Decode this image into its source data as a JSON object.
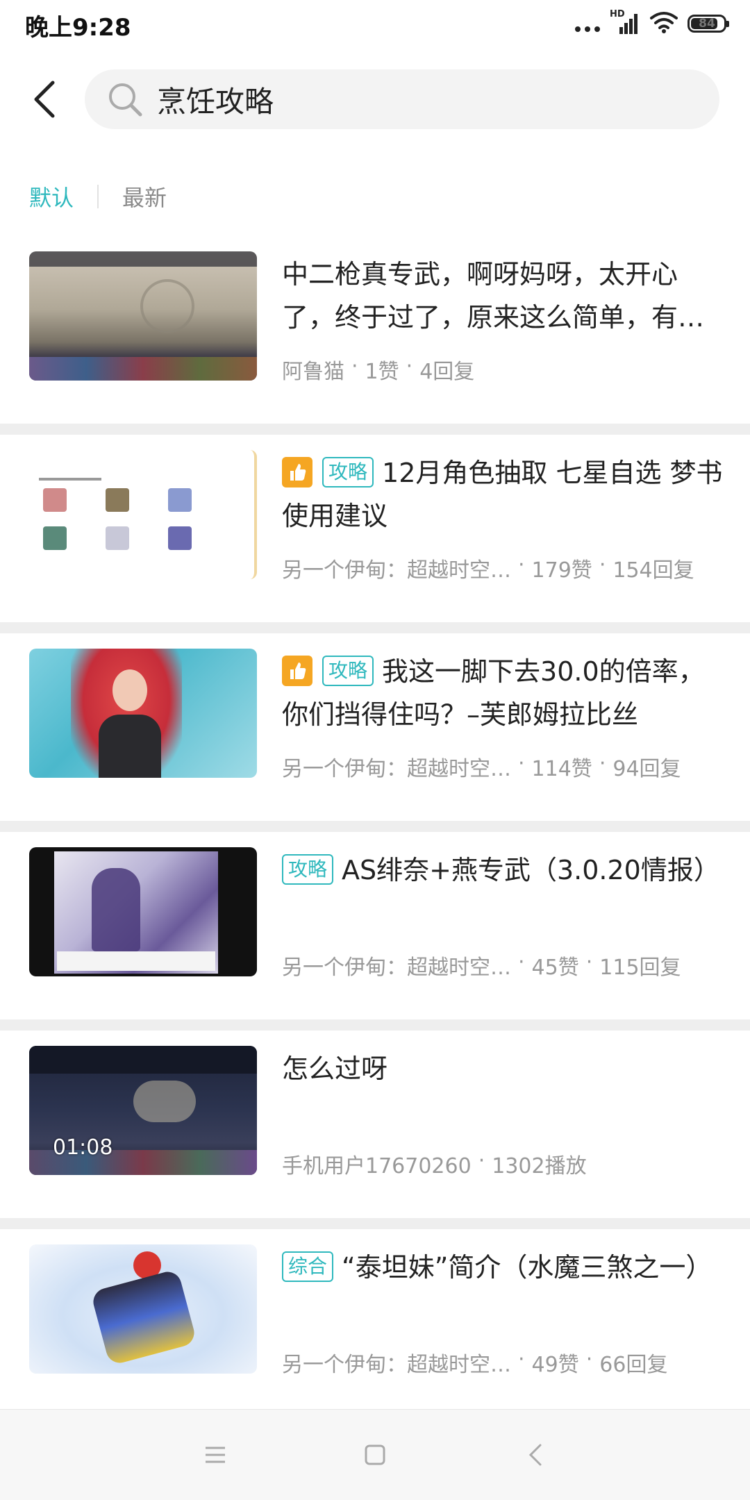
{
  "status_bar": {
    "time": "晚上9:28",
    "signal_label": "HD",
    "battery": "84",
    "battery_level": 0.84
  },
  "search": {
    "query": "烹饪攻略"
  },
  "tabs": [
    {
      "label": "默认",
      "active": true
    },
    {
      "label": "最新",
      "active": false
    }
  ],
  "colors": {
    "accent": "#2eb8bd",
    "hot_badge": "#f5a623",
    "meta_text": "#999999",
    "divider": "#eeeeee"
  },
  "posts": [
    {
      "title": "中二枪真专武，啊呀妈呀，太开心了，终于过了，原来这么简单，有…",
      "author": "阿鲁猫",
      "stats": [
        "1赞",
        "4回复"
      ],
      "tag": "",
      "hot": false,
      "duration": ""
    },
    {
      "title": "12月角色抽取 七星自选 梦书使用建议",
      "author": "另一个伊甸：超越时空…",
      "stats": [
        "179赞",
        "154回复"
      ],
      "tag": "攻略",
      "hot": true,
      "duration": ""
    },
    {
      "title": "我这一脚下去30.0的倍率，你们挡得住吗？–芙郎姆拉比丝",
      "author": "另一个伊甸：超越时空…",
      "stats": [
        "114赞",
        "94回复"
      ],
      "tag": "攻略",
      "hot": true,
      "duration": ""
    },
    {
      "title": "AS绯奈+燕专武（3.0.20情报）",
      "author": "另一个伊甸：超越时空…",
      "stats": [
        "45赞",
        "115回复"
      ],
      "tag": "攻略",
      "hot": false,
      "duration": ""
    },
    {
      "title": "怎么过呀",
      "author": "手机用户17670260",
      "stats": [
        "1302播放"
      ],
      "tag": "",
      "hot": false,
      "duration": "01:08"
    },
    {
      "title": "“泰坦妹”简介（水魔三煞之一）",
      "author": "另一个伊甸：超越时空…",
      "stats": [
        "49赞",
        "66回复"
      ],
      "tag": "综合",
      "hot": false,
      "duration": ""
    }
  ]
}
